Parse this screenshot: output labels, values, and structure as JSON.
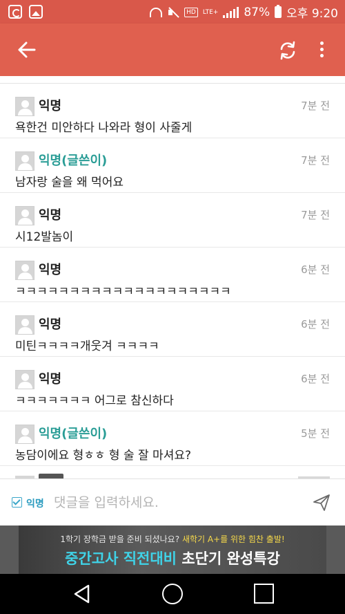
{
  "status_bar": {
    "battery": "87%",
    "time": "오후 9:20",
    "hd": "HD",
    "lte": "LTE+"
  },
  "app_bar": {
    "back_icon": "back-arrow-icon",
    "refresh_icon": "refresh-icon",
    "more_icon": "more-vert-icon",
    "color": "#e0604f"
  },
  "comments": [
    {
      "author": "익명",
      "time": "7분 전",
      "text": "욕한건 미안하다 나와라 형이 사줄게",
      "is_writer": false
    },
    {
      "author": "익명(글쓴이)",
      "time": "7분 전",
      "text": "남자랑 술을 왜 먹어요",
      "is_writer": true
    },
    {
      "author": "익명",
      "time": "7분 전",
      "text": "시12발놈이",
      "is_writer": false
    },
    {
      "author": "익명",
      "time": "6분 전",
      "text": "ㅋㅋㅋㅋㅋㅋㅋㅋㅋㅋㅋㅋㅋㅋㅋㅋㅋㅋㅋㅋ",
      "is_writer": false
    },
    {
      "author": "익명",
      "time": "6분 전",
      "text": "미틴ㅋㅋㅋㅋ개웃겨 ㅋㅋㅋㅋ",
      "is_writer": false
    },
    {
      "author": "익명",
      "time": "6분 전",
      "text": "ㅋㅋㅋㅋㅋㅋㅋ 어그로 참신하다",
      "is_writer": false
    },
    {
      "author": "익명(글쓴이)",
      "time": "5분 전",
      "text": "농담이에요 형ㅎㅎ 형 술 잘 마셔요?",
      "is_writer": true
    }
  ],
  "input_bar": {
    "anonymous_label": "익명",
    "anonymous_checked": true,
    "placeholder": "댓글을 입력하세요.",
    "value": ""
  },
  "ad": {
    "line1_prefix": "1학기 장학금 받을 준비 되셨나요?",
    "line1_highlight": "새학기 A+를 위한 힘찬 출발!",
    "line2_cyan": "중간고사 직전대비",
    "line2_white": "초단기 완성특강"
  },
  "colors": {
    "accent": "#e0604f",
    "writer": "#2a9d96",
    "anonymous_check": "#3aa6c9"
  }
}
